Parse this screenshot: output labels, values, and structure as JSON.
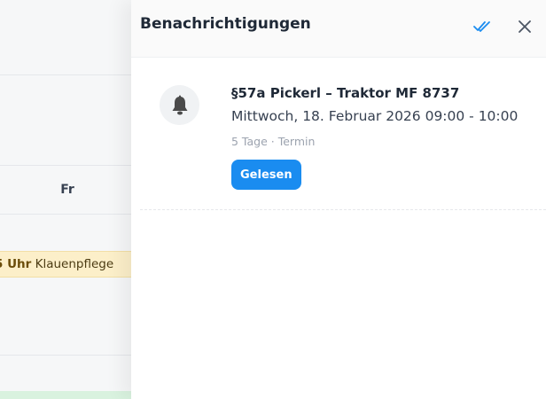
{
  "calendar": {
    "day_label": "Fr",
    "event_time": "5 Uhr",
    "event_title": "Klauenpflege"
  },
  "panel": {
    "title": "Benachrichtigungen",
    "mark_all_icon": "double-check-icon",
    "close_icon": "close-icon"
  },
  "notifications": [
    {
      "icon": "bell-icon",
      "title": "§57a Pickerl – Traktor MF 8737",
      "datetime": "Mittwoch, 18. Februar 2026 09:00 - 10:00",
      "meta": "5 Tage · Termin",
      "read_label": "Gelesen"
    }
  ],
  "colors": {
    "accent": "#1a8cf0",
    "event_bg": "#fcefc9",
    "green_bar": "#d9f2df"
  }
}
